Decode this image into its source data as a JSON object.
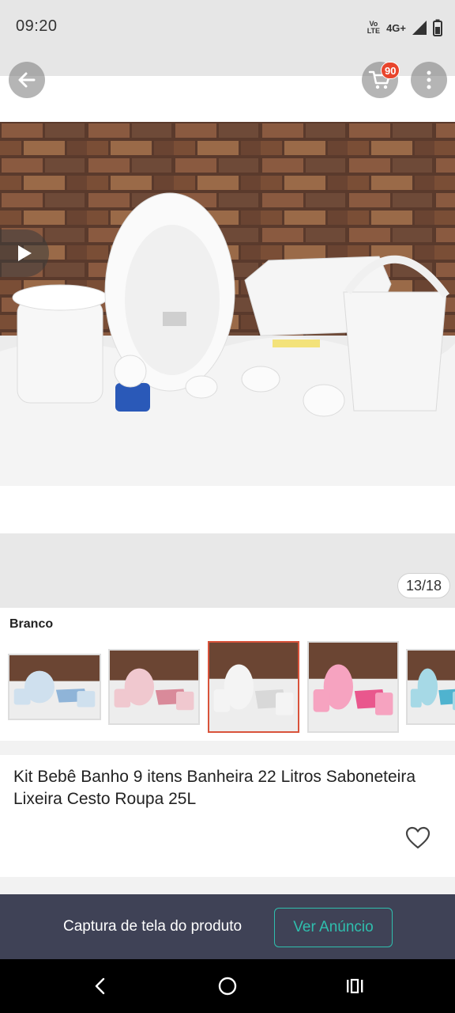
{
  "status_bar": {
    "time": "09:20",
    "volte_top": "Vo",
    "volte_bottom": "LTE",
    "network": "4G+"
  },
  "header": {
    "cart_count": "90"
  },
  "gallery": {
    "counter": "13/18"
  },
  "variation": {
    "label": "Branco",
    "options": [
      {
        "color": "#cfe0ee",
        "accent": "#8fb4d8",
        "selected": false
      },
      {
        "color": "#f0c8cf",
        "accent": "#d98a9a",
        "selected": false
      },
      {
        "color": "#f4f4f4",
        "accent": "#d8d8d8",
        "selected": true
      },
      {
        "color": "#f6a3c0",
        "accent": "#e9578d",
        "selected": false
      },
      {
        "color": "#a6d9e6",
        "accent": "#4fb3cf",
        "selected": false
      }
    ]
  },
  "product": {
    "title": "Kit Bebê Banho 9 itens Banheira 22 Litros Saboneteira Lixeira  Cesto Roupa 25L"
  },
  "banner": {
    "text": "Captura de tela do produto",
    "button_label": "Ver Anúncio"
  },
  "colors": {
    "accent": "#2fbfae",
    "badge": "#e8452c",
    "banner_bg": "#3f4256",
    "selected_border": "#d9533b"
  },
  "icons": [
    "back-arrow-icon",
    "cart-icon",
    "more-vertical-icon",
    "play-icon",
    "heart-icon",
    "nav-back-icon",
    "nav-home-icon",
    "nav-recents-icon",
    "signal-icon",
    "battery-icon"
  ]
}
